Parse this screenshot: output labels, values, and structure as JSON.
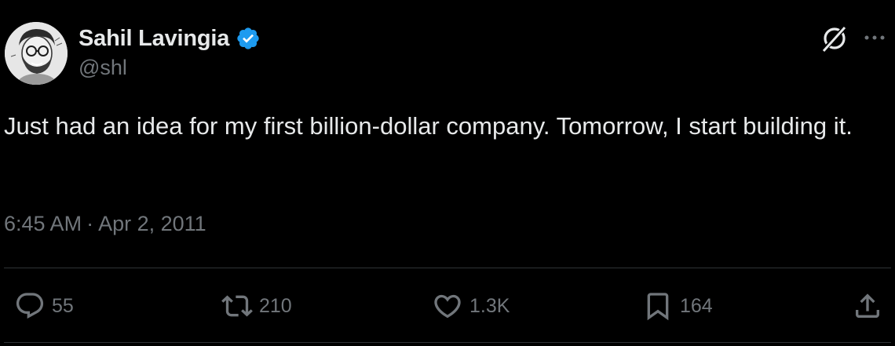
{
  "author": {
    "display_name": "Sahil Lavingia",
    "handle": "@shl",
    "verified": true,
    "verified_color": "#1d9bf0"
  },
  "header_icons": [
    "grok-icon",
    "more-icon"
  ],
  "tweet": {
    "text": "Just had an idea for my first billion-dollar company. Tomorrow, I start building it.",
    "time": "6:45 AM",
    "separator": "·",
    "date": "Apr 2, 2011"
  },
  "actions": {
    "reply": {
      "icon": "reply-icon",
      "count": "55"
    },
    "retweet": {
      "icon": "retweet-icon",
      "count": "210"
    },
    "like": {
      "icon": "heart-icon",
      "count": "1.3K"
    },
    "bookmark": {
      "icon": "bookmark-icon",
      "count": "164"
    },
    "share": {
      "icon": "share-icon"
    }
  },
  "colors": {
    "background": "#000000",
    "primary_text": "#e7e9ea",
    "secondary_text": "#71767b",
    "divider": "#2f3336"
  }
}
